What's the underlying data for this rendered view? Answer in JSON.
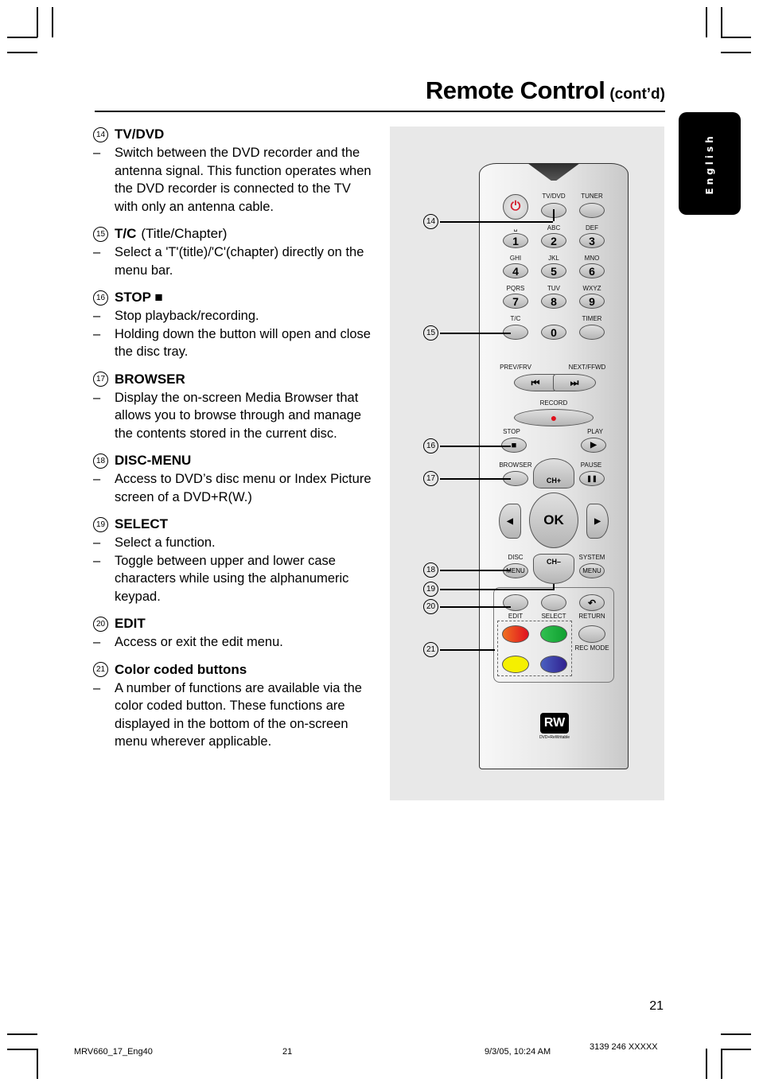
{
  "header": {
    "title": "Remote Control",
    "subtitle": "(cont’d)"
  },
  "language_tab": "English",
  "items": [
    {
      "number": "14",
      "label": "TV/DVD",
      "extra": "",
      "bullets": [
        "Switch between the DVD recorder and the antenna signal. This function operates when the DVD recorder is connected to the TV with only an antenna cable."
      ]
    },
    {
      "number": "15",
      "label": "T/C",
      "extra": "(Title/Chapter)",
      "bullets": [
        "Select a 'T'(title)/'C'(chapter) directly on the menu bar."
      ]
    },
    {
      "number": "16",
      "label": "STOP ■",
      "extra": "",
      "bullets": [
        "Stop playback/recording.",
        "Holding down the button will open and close the disc tray."
      ]
    },
    {
      "number": "17",
      "label": "BROWSER",
      "extra": "",
      "bullets": [
        "Display the on-screen Media Browser that allows you to browse through and manage the contents stored in the current disc."
      ]
    },
    {
      "number": "18",
      "label": "DISC-MENU",
      "extra": "",
      "bullets": [
        "Access to DVD’s disc menu or Index Picture screen of a DVD+R(W.)"
      ]
    },
    {
      "number": "19",
      "label": "SELECT",
      "extra": "",
      "bullets": [
        "Select a function.",
        "Toggle between upper and lower case characters while using the alphanumeric keypad."
      ]
    },
    {
      "number": "20",
      "label": "EDIT",
      "extra": "",
      "bullets": [
        "Access or exit the edit menu."
      ]
    },
    {
      "number": "21",
      "label": "Color coded buttons",
      "extra": "",
      "bullets": [
        "A number of functions are available via the color coded button. These functions are displayed in the bottom of the on-screen menu wherever applicable."
      ]
    }
  ],
  "remote": {
    "labels": {
      "tvdvd": "TV/DVD",
      "tuner": "TUNER",
      "space": "␣",
      "abc": "ABC",
      "def": "DEF",
      "ghi": "GHI",
      "jkl": "JKL",
      "mno": "MNO",
      "pqrs": "PQRS",
      "tuv": "TUV",
      "wxyz": "WXYZ",
      "tc": "T/C",
      "timer": "TIMER",
      "prev": "PREV/FRV",
      "next": "NEXT/FFWD",
      "record": "RECORD",
      "stop": "STOP",
      "play": "PLAY",
      "browser": "BROWSER",
      "pause": "PAUSE",
      "chplus": "CH+",
      "chminus": "CH–",
      "ok": "OK",
      "disc": "DISC",
      "system": "SYSTEM",
      "menu": "MENU",
      "edit": "EDIT",
      "select": "SELECT",
      "return": "RETURN",
      "recmode": "REC MODE",
      "rw_logo": "RW",
      "rw_caption": "DVD+ReWritable"
    },
    "digits": [
      "1",
      "2",
      "3",
      "4",
      "5",
      "6",
      "7",
      "8",
      "9",
      "0"
    ],
    "icons": {
      "power": "⏻",
      "prev": "⏮",
      "next": "⏭",
      "record": "●",
      "stop": "■",
      "play": "▶",
      "pause": "❚❚",
      "up": "▲",
      "down": "▼",
      "left": "◀",
      "right": "▶",
      "return": "↶"
    },
    "colors": {
      "power": "#d42030",
      "record": "#e0101c",
      "red": "#e01020",
      "green": "#10a030",
      "yellow": "#f5f000",
      "blue": "#302090"
    },
    "callouts": [
      "14",
      "15",
      "16",
      "17",
      "18",
      "19",
      "20",
      "21"
    ]
  },
  "footer": {
    "page_number": "21",
    "file": "MRV660_17_Eng40",
    "sheet": "21",
    "timestamp": "9/3/05, 10:24 AM",
    "code": "3139 246 XXXXX"
  }
}
